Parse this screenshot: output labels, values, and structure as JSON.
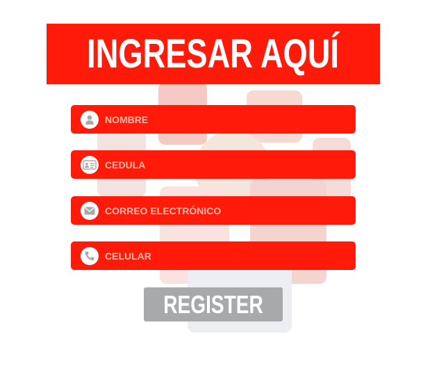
{
  "header": {
    "title": "INGRESAR AQUÍ"
  },
  "form": {
    "fields": [
      {
        "placeholder": "NOMBRE",
        "icon": "user-icon"
      },
      {
        "placeholder": "CEDULA",
        "icon": "id-card-icon"
      },
      {
        "placeholder": "CORREO ELECTRÓNICO",
        "icon": "envelope-icon"
      },
      {
        "placeholder": "CELULAR",
        "icon": "phone-icon"
      }
    ],
    "submit_label": "REGISTER"
  },
  "colors": {
    "accent": "#ff1a0a",
    "button": "#a7a9ab",
    "icon": "#a7a9ab"
  }
}
